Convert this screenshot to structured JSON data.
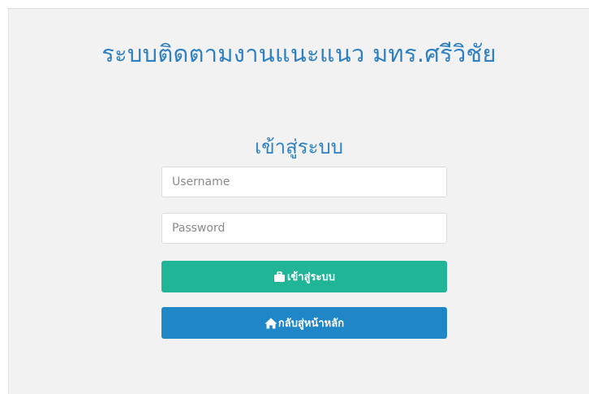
{
  "site_title": "ระบบติดตามงานแนะแนว มทร.ศรีวิชัย",
  "login_heading": "เข้าสู่ระบบ",
  "form": {
    "username_placeholder": "Username",
    "password_placeholder": "Password",
    "username_value": "",
    "password_value": ""
  },
  "buttons": {
    "login_label": "เข้าสู่ระบบ",
    "login_icon": "briefcase-icon",
    "home_label": "กลับสู่หน้าหลัก",
    "home_icon": "home-icon"
  },
  "colors": {
    "title": "#2f80c3",
    "login_button": "#1fb596",
    "home_button": "#1f86c8",
    "panel_background": "#f2f2f2"
  }
}
